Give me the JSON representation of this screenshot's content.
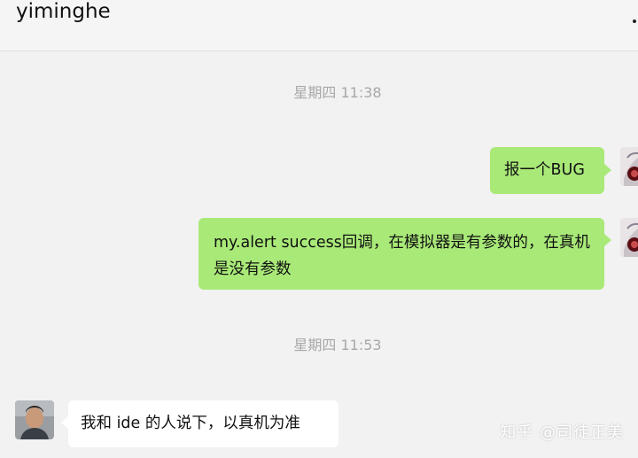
{
  "header": {
    "title": "yiminghe"
  },
  "messages": [
    {
      "type": "time",
      "text": "星期四 11:38"
    },
    {
      "type": "sent",
      "text": "报一个BUG"
    },
    {
      "type": "sent",
      "text": "my.alert success回调，在模拟器是有参数的，在真机是没有参数"
    },
    {
      "type": "time",
      "text": "星期四 11:53"
    },
    {
      "type": "received",
      "text": "我和 ide 的人说下，以真机为准"
    }
  ],
  "watermark": "知乎 @司徒正美",
  "colors": {
    "sent_bubble": "#a9e978",
    "received_bubble": "#ffffff",
    "chat_background": "#f2f2f2"
  }
}
